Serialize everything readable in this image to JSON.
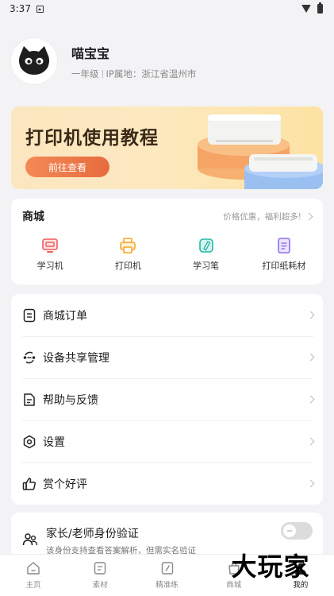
{
  "status_bar": {
    "time": "3:37"
  },
  "profile": {
    "name": "喵宝宝",
    "grade": "一年级",
    "ip_location": "IP属地：浙江省温州市"
  },
  "banner": {
    "title": "打印机使用教程",
    "button_label": "前往查看"
  },
  "shop": {
    "title": "商城",
    "promo": "价格优惠，福利超多!",
    "items": [
      {
        "label": "学习机",
        "icon": "learning-machine-icon",
        "color": "#f05a5a"
      },
      {
        "label": "打印机",
        "icon": "printer-icon",
        "color": "#f5a623"
      },
      {
        "label": "学习笔",
        "icon": "learning-pen-icon",
        "color": "#26b8a6"
      },
      {
        "label": "打印纸耗材",
        "icon": "paper-supplies-icon",
        "color": "#8e6cf0"
      }
    ]
  },
  "menu": {
    "items": [
      {
        "label": "商城订单",
        "icon": "order-icon"
      },
      {
        "label": "设备共享管理",
        "icon": "device-share-icon"
      },
      {
        "label": "帮助与反馈",
        "icon": "help-feedback-icon"
      },
      {
        "label": "设置",
        "icon": "settings-icon"
      },
      {
        "label": "赏个好评",
        "icon": "thumbs-up-icon"
      }
    ]
  },
  "verify": {
    "title": "家长/老师身份验证",
    "description": "该身份支持查看答案解析，但需实名验证",
    "enabled": false
  },
  "tabbar": {
    "tabs": [
      {
        "label": "主页",
        "icon": "home-icon"
      },
      {
        "label": "素材",
        "icon": "material-icon"
      },
      {
        "label": "精准练",
        "icon": "practice-icon"
      },
      {
        "label": "商城",
        "icon": "shop-icon"
      },
      {
        "label": "我的",
        "icon": "profile-icon"
      }
    ],
    "active_index": 4
  },
  "watermark": {
    "text": "大玩家"
  },
  "colors": {
    "accent": "#e86b3e",
    "banner_bg": "#fde9c0"
  }
}
